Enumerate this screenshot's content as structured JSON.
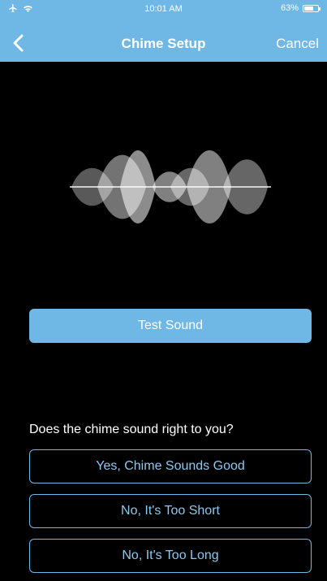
{
  "status_bar": {
    "time": "10:01 AM",
    "battery": "63%",
    "battery_level": 0.63,
    "icons": [
      "airplane-icon",
      "wifi-icon",
      "battery-icon"
    ]
  },
  "nav": {
    "title": "Chime Setup",
    "cancel_label": "Cancel",
    "back_icon": "chevron-left-icon"
  },
  "waveform": {
    "icon": "sound-wave-icon"
  },
  "test_button_label": "Test Sound",
  "question": "Does the chime sound right to you?",
  "options": [
    "Yes, Chime Sounds Good",
    "No, It's Too Short",
    "No, It's Too Long"
  ],
  "colors": {
    "accent": "#6fb8e6",
    "background": "#000000",
    "option_text": "#8fc8ee"
  }
}
